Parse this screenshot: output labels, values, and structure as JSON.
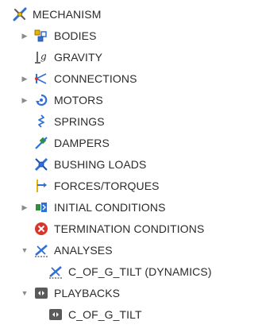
{
  "tree": {
    "root": {
      "label": "MECHANISM",
      "icon": "mechanism-icon"
    },
    "items": [
      {
        "label": "BODIES",
        "icon": "bodies-icon",
        "expandable": true,
        "expanded": false
      },
      {
        "label": "GRAVITY",
        "icon": "gravity-icon",
        "expandable": false
      },
      {
        "label": "CONNECTIONS",
        "icon": "connections-icon",
        "expandable": true,
        "expanded": false
      },
      {
        "label": "MOTORS",
        "icon": "motors-icon",
        "expandable": true,
        "expanded": false
      },
      {
        "label": "SPRINGS",
        "icon": "springs-icon",
        "expandable": false
      },
      {
        "label": "DAMPERS",
        "icon": "dampers-icon",
        "expandable": false
      },
      {
        "label": "BUSHING LOADS",
        "icon": "bushing-loads-icon",
        "expandable": false
      },
      {
        "label": "FORCES/TORQUES",
        "icon": "forces-torques-icon",
        "expandable": false
      },
      {
        "label": "INITIAL CONDITIONS",
        "icon": "initial-conditions-icon",
        "expandable": true,
        "expanded": false
      },
      {
        "label": "TERMINATION CONDITIONS",
        "icon": "termination-conditions-icon",
        "expandable": false
      },
      {
        "label": "ANALYSES",
        "icon": "analyses-icon",
        "expandable": true,
        "expanded": true,
        "children": [
          {
            "label": "C_OF_G_TILT (DYNAMICS)",
            "icon": "analysis-icon"
          }
        ]
      },
      {
        "label": "PLAYBACKS",
        "icon": "playbacks-icon",
        "expandable": true,
        "expanded": true,
        "children": [
          {
            "label": "C_OF_G_TILT",
            "icon": "playback-icon"
          }
        ]
      }
    ]
  },
  "colors": {
    "text": "#2b2b2b",
    "caret": "#8a8a8a",
    "blue": "#2f6fd6",
    "red": "#d9342b",
    "yellow": "#e8b400",
    "green": "#2f8f3a"
  }
}
